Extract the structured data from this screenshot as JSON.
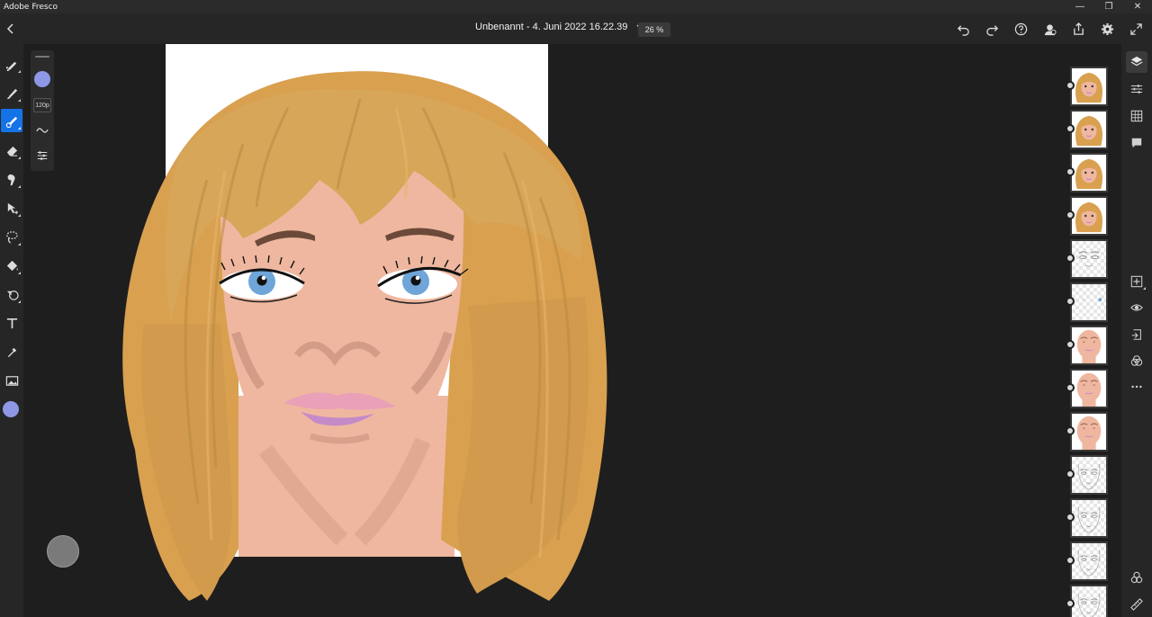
{
  "window": {
    "app_name": "Adobe Fresco",
    "controls": {
      "minimize": "—",
      "restore": "❐",
      "close": "✕"
    }
  },
  "appbar": {
    "back_icon": "chevron-left-icon",
    "document_title": "Unbenannt - 4. Juni 2022 16.22.39",
    "title_menu_icon": "chevron-down-icon",
    "zoom": "26 %",
    "actions": [
      "undo-icon",
      "redo-icon",
      "help-icon",
      "profile-icon",
      "share-icon",
      "settings-icon",
      "fullscreen-icon"
    ]
  },
  "tools": [
    "pixel-brush-icon",
    "live-brush-icon",
    "vector-brush-icon",
    "eraser-icon",
    "smudge-icon",
    "move-transform-icon",
    "lasso-select-icon",
    "paint-bucket-icon",
    "shape-icon",
    "text-icon",
    "eyedropper-icon",
    "place-image-icon"
  ],
  "active_tool": "vector-brush-icon",
  "brush_panel": {
    "color": "#8e98e6",
    "size": "120p",
    "smoothing_icon": "wave-icon",
    "settings_icon": "brush-settings-icon"
  },
  "current_color": "#8e98e6",
  "colors": {
    "accent": "#1473e6",
    "hair": "#d9a04f",
    "skin": "#efb79f",
    "iris": "#6fa5d9",
    "lips": "#c58ac8",
    "panel": "#262626",
    "canvas_bg": "#1e1e1e"
  },
  "layers": {
    "count_visible": 13,
    "thumbnails": [
      "hair",
      "hair",
      "hair",
      "hair",
      "eyes-sketch",
      "eyes-iris",
      "face-skin",
      "face-skin",
      "face-skin",
      "face-line",
      "face-line",
      "face-line",
      "face-line"
    ]
  },
  "right_toolbar": [
    "layers-icon",
    "layer-properties-icon",
    "grid-icon",
    "comments-icon",
    "add-layer-icon",
    "visibility-icon",
    "import-icon",
    "blend-mode-icon",
    "more-icon",
    "assets-icon",
    "ruler-icon"
  ]
}
